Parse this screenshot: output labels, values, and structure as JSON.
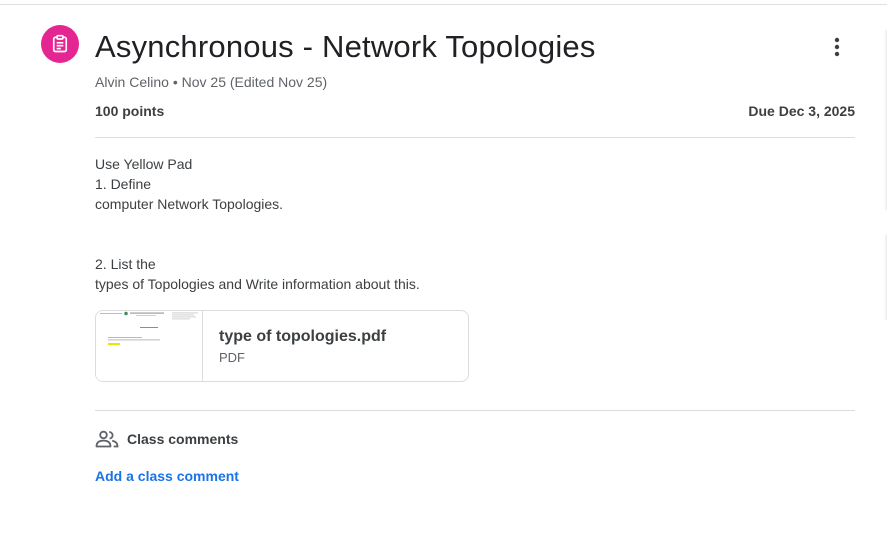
{
  "assignment": {
    "title": "Asynchronous - Network Topologies",
    "author": "Alvin Celino",
    "meta_separator": " • ",
    "posted": "Nov 25 (Edited Nov 25)",
    "points": "100 points",
    "due": "Due Dec 3, 2025",
    "icon": "assignment-icon",
    "icon_color": "#e52592"
  },
  "description": {
    "lines": [
      "Use Yellow Pad",
      "1. Define",
      "computer Network Topologies.",
      "",
      "",
      "2. List the",
      "types of Topologies and Write information about this."
    ]
  },
  "attachment": {
    "name": "type of topologies.pdf",
    "type": "PDF",
    "thumbnail": "pdf-thumbnail"
  },
  "comments": {
    "title": "Class comments",
    "add_label": "Add a class comment",
    "icon": "people-icon",
    "link_color": "#1a73e8"
  },
  "menu": {
    "icon": "more-vert-icon"
  }
}
